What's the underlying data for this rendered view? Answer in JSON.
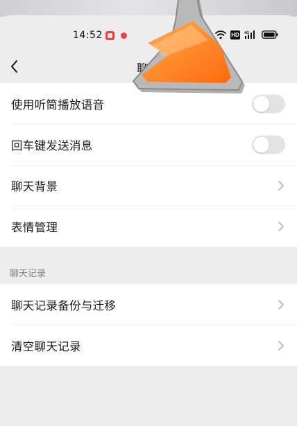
{
  "status_bar": {
    "time": "14:52",
    "hd_badge": "HD",
    "icons": [
      "app-notification-icon",
      "notification-dot-icon",
      "wifi-icon",
      "hd-icon",
      "signal-icon",
      "battery-icon"
    ]
  },
  "header": {
    "title": "聊天",
    "back_icon": "chevron-left-icon"
  },
  "settings": {
    "group1": [
      {
        "label": "使用听筒播放语音",
        "control": "toggle",
        "on": false
      },
      {
        "label": "回车键发送消息",
        "control": "toggle",
        "on": false
      },
      {
        "label": "聊天背景",
        "control": "chevron-right-icon"
      },
      {
        "label": "表情管理",
        "control": "chevron-right-icon"
      }
    ],
    "section_header": "聊天记录",
    "group2": [
      {
        "label": "聊天记录备份与迁移",
        "control": "chevron-right-icon"
      },
      {
        "label": "清空聊天记录",
        "control": "chevron-right-icon"
      }
    ]
  },
  "overlay": {
    "pointer_icon": "pointer-arrow-icon",
    "colors": {
      "fill": "#ff7a1a",
      "highlight": "#ffb060",
      "shadow": "#7a7a7a"
    }
  },
  "colors": {
    "page_background": "#ededed",
    "card_background": "#ffffff",
    "toggle_off": "#e3e3e3",
    "notification_red": "#e8434a"
  }
}
